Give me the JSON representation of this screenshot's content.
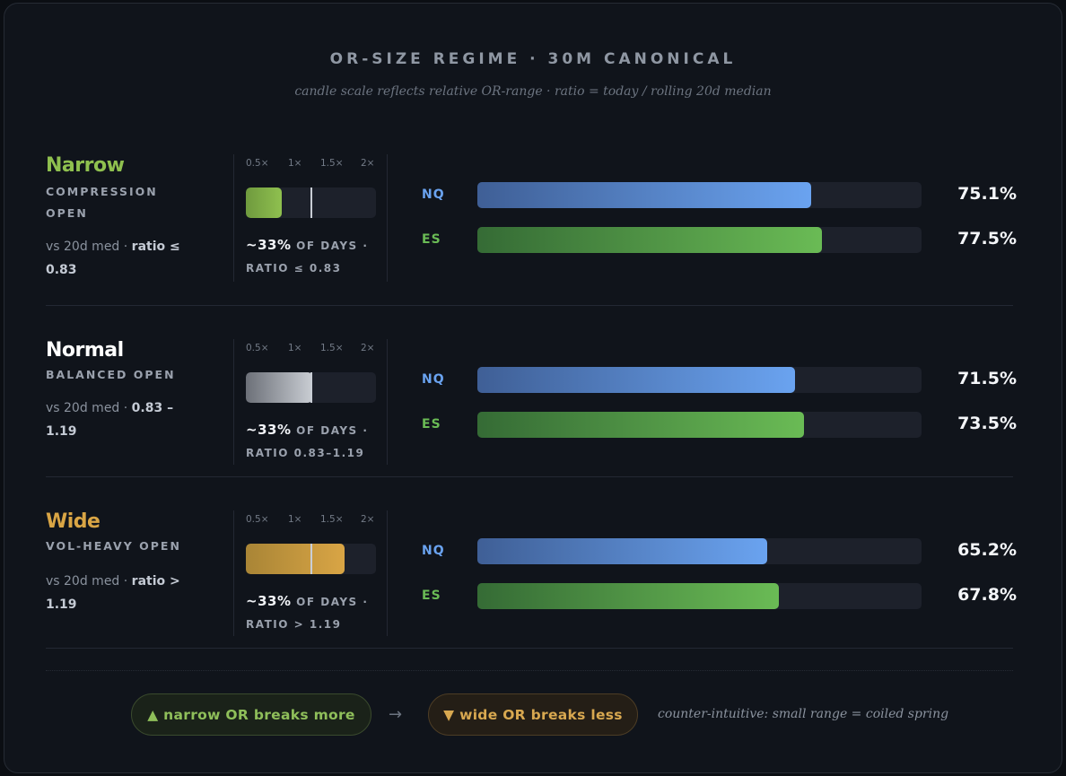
{
  "header": {
    "title": "OR-SIZE REGIME  ·  30M CANONICAL",
    "subtitle": "candle scale reflects relative OR-range  ·  ratio = today / rolling 20d median"
  },
  "colors": {
    "narrow": "#8fc04f",
    "normal": "#ffffff",
    "wide": "#d9a545",
    "nq": "#6aa3f0",
    "es": "#6abb55"
  },
  "scale_ticks": [
    "0.5×",
    "1×",
    "1.5×",
    "2×"
  ],
  "chart_data": {
    "type": "bar",
    "categories": [
      "Narrow",
      "Normal",
      "Wide"
    ],
    "series": [
      {
        "name": "NQ",
        "values": [
          75.1,
          71.5,
          65.2
        ]
      },
      {
        "name": "ES",
        "values": [
          77.5,
          73.5,
          67.8
        ]
      }
    ],
    "unit": "%",
    "ylim": [
      0,
      100
    ]
  },
  "regimes": [
    {
      "name": "Narrow",
      "sub": "COMPRESSION OPEN",
      "range_prefix": "vs 20d med  ·  ",
      "range_value": "ratio ≤ 0.83",
      "share": "~33%",
      "caption_a": " OF DAYS ·",
      "caption_b": "RATIO ≤ 0.83",
      "candle_ratio": 0.83,
      "nq_label": "NQ",
      "nq_value": "75.1%",
      "es_label": "ES",
      "es_value": "77.5%"
    },
    {
      "name": "Normal",
      "sub": "BALANCED OPEN",
      "range_prefix": "vs 20d med  ·  ",
      "range_value": "0.83 – 1.19",
      "share": "~33%",
      "caption_a": " OF DAYS ·",
      "caption_b": "RATIO 0.83–1.19",
      "candle_ratio": 1.0,
      "nq_label": "NQ",
      "nq_value": "71.5%",
      "es_label": "ES",
      "es_value": "73.5%"
    },
    {
      "name": "Wide",
      "sub": "VOL-HEAVY OPEN",
      "range_prefix": "vs 20d med  ·  ",
      "range_value": "ratio > 1.19",
      "share": "~33%",
      "caption_a": " OF DAYS ·",
      "caption_b": "RATIO > 1.19",
      "candle_ratio": 1.19,
      "nq_label": "NQ",
      "nq_value": "65.2%",
      "es_label": "ES",
      "es_value": "67.8%"
    }
  ],
  "footer": {
    "pill_narrow": "▲ narrow OR breaks more",
    "arrow": "→",
    "pill_wide": "▼ wide OR breaks less",
    "note": "counter-intuitive: small range = coiled spring"
  }
}
